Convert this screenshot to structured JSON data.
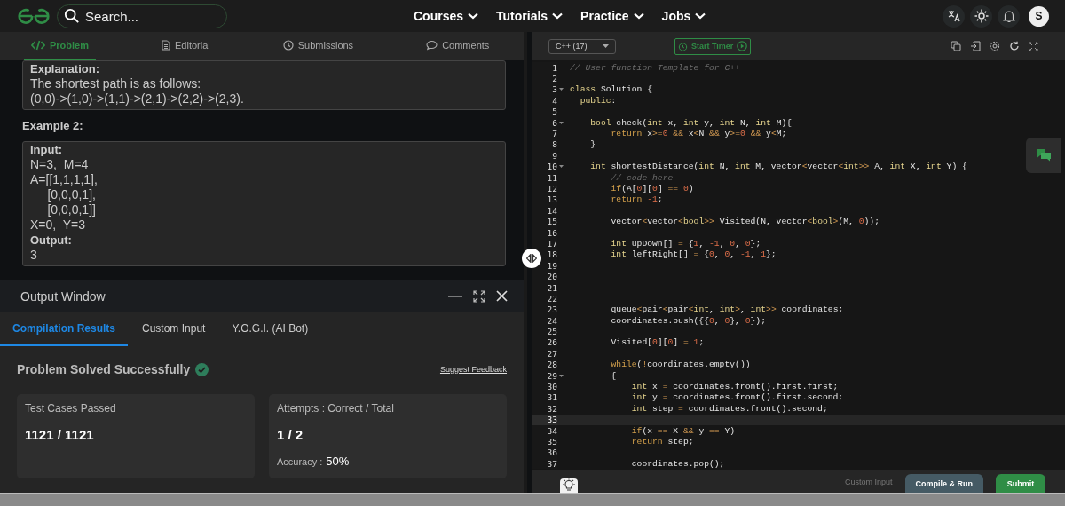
{
  "header": {
    "search": {
      "placeholder": "Search..."
    },
    "nav": [
      {
        "label": "Courses"
      },
      {
        "label": "Tutorials"
      },
      {
        "label": "Practice"
      },
      {
        "label": "Jobs"
      }
    ],
    "avatar": "S"
  },
  "problem_tabs": [
    {
      "label": "Problem",
      "selected": true
    },
    {
      "label": "Editorial",
      "selected": false
    },
    {
      "label": "Submissions",
      "selected": false
    },
    {
      "label": "Comments",
      "selected": false
    }
  ],
  "problem": {
    "explanation": {
      "heading": "Explanation:",
      "lines": [
        "The shortest path is as follows:",
        "(0,0)->(1,0)->(1,1)->(2,1)->(2,2)->(2,3)."
      ]
    },
    "example": {
      "heading": "Example 2:",
      "input_label": "Input:",
      "input_lines": [
        "N=3,  M=4",
        "A=[[1,1,1,1],",
        "     [0,0,0,1],",
        "     [0,0,0,1]]",
        "X=0,  Y=3"
      ],
      "output_label": "Output:",
      "output_lines": [
        "3"
      ]
    }
  },
  "output_window": {
    "title": "Output Window",
    "tabs": [
      {
        "label": "Compilation Results",
        "selected": true
      },
      {
        "label": "Custom Input",
        "selected": false
      },
      {
        "label": "Y.O.G.I. (AI Bot)",
        "selected": false
      }
    ],
    "status": "Problem Solved Successfully",
    "feedback_link": "Suggest Feedback",
    "cards": [
      {
        "label": "Test Cases Passed",
        "value": "1121 / 1121"
      },
      {
        "label": "Attempts : Correct / Total",
        "value": "1 / 2",
        "accuracy_label": "Accuracy :",
        "accuracy_value": "50%"
      }
    ]
  },
  "editor": {
    "language": "C++ (17)",
    "timer": "Start Timer",
    "lines": [
      {
        "number": "1",
        "fold": false,
        "current": false,
        "segments": [
          {
            "kind": "cmt",
            "text": "// User function Template for C++"
          }
        ]
      },
      {
        "number": "2",
        "fold": false,
        "current": false
      },
      {
        "number": "3",
        "fold": true,
        "current": false,
        "segments": [
          {
            "kind": "kw",
            "text": "class"
          },
          {
            "kind": "txt",
            "text": " Solution {"
          }
        ]
      },
      {
        "number": "4",
        "fold": false,
        "current": false,
        "segments": [
          {
            "kind": "kw",
            "text": "  public"
          },
          {
            "kind": "txt",
            "text": ":"
          }
        ]
      },
      {
        "number": "5",
        "fold": false,
        "current": false
      },
      {
        "number": "6",
        "fold": true,
        "current": false,
        "segments": [
          {
            "kind": "kw",
            "text": "    bool"
          },
          {
            "kind": "txt",
            "text": " check("
          },
          {
            "kind": "kw",
            "text": "int"
          },
          {
            "kind": "txt",
            "text": " x, "
          },
          {
            "kind": "kw",
            "text": "int"
          },
          {
            "kind": "txt",
            "text": " y, "
          },
          {
            "kind": "kw",
            "text": "int"
          },
          {
            "kind": "txt",
            "text": " N, "
          },
          {
            "kind": "kw",
            "text": "int"
          },
          {
            "kind": "txt",
            "text": " M){"
          }
        ]
      },
      {
        "number": "7",
        "fold": false,
        "current": false,
        "segments": [
          {
            "kind": "ctrl",
            "text": "        return"
          },
          {
            "kind": "txt",
            "text": " x"
          },
          {
            "kind": "op",
            "text": ">="
          },
          {
            "kind": "num",
            "text": "0"
          },
          {
            "kind": "op",
            "text": " && "
          },
          {
            "kind": "txt",
            "text": "x"
          },
          {
            "kind": "op",
            "text": "<"
          },
          {
            "kind": "txt",
            "text": "N "
          },
          {
            "kind": "op",
            "text": "&&"
          },
          {
            "kind": "txt",
            "text": " y"
          },
          {
            "kind": "op",
            "text": ">="
          },
          {
            "kind": "num",
            "text": "0"
          },
          {
            "kind": "op",
            "text": " && "
          },
          {
            "kind": "txt",
            "text": "y"
          },
          {
            "kind": "op",
            "text": "<"
          },
          {
            "kind": "txt",
            "text": "M;"
          }
        ]
      },
      {
        "number": "8",
        "fold": false,
        "current": false,
        "segments": [
          {
            "kind": "txt",
            "text": "    }"
          }
        ]
      },
      {
        "number": "9",
        "fold": false,
        "current": false
      },
      {
        "number": "10",
        "fold": true,
        "current": false,
        "segments": [
          {
            "kind": "kw",
            "text": "    int"
          },
          {
            "kind": "txt",
            "text": " shortestDistance("
          },
          {
            "kind": "kw",
            "text": "int"
          },
          {
            "kind": "txt",
            "text": " N, "
          },
          {
            "kind": "kw",
            "text": "int"
          },
          {
            "kind": "txt",
            "text": " M, vector"
          },
          {
            "kind": "op",
            "text": "<"
          },
          {
            "kind": "txt",
            "text": "vector"
          },
          {
            "kind": "op",
            "text": "<"
          },
          {
            "kind": "kw",
            "text": "int"
          },
          {
            "kind": "op",
            "text": ">>"
          },
          {
            "kind": "txt",
            "text": " A, "
          },
          {
            "kind": "kw",
            "text": "int"
          },
          {
            "kind": "txt",
            "text": " X, "
          },
          {
            "kind": "kw",
            "text": "int"
          },
          {
            "kind": "txt",
            "text": " Y) {"
          }
        ]
      },
      {
        "number": "11",
        "fold": false,
        "current": false,
        "segments": [
          {
            "kind": "cmt",
            "text": "        // code here"
          }
        ]
      },
      {
        "number": "12",
        "fold": false,
        "current": false,
        "segments": [
          {
            "kind": "ctrl",
            "text": "        if"
          },
          {
            "kind": "txt",
            "text": "(A["
          },
          {
            "kind": "num",
            "text": "0"
          },
          {
            "kind": "txt",
            "text": "]["
          },
          {
            "kind": "num",
            "text": "0"
          },
          {
            "kind": "txt",
            "text": "] "
          },
          {
            "kind": "op",
            "text": "=="
          },
          {
            "kind": "num",
            "text": " 0"
          },
          {
            "kind": "txt",
            "text": ")"
          }
        ]
      },
      {
        "number": "13",
        "fold": false,
        "current": false,
        "segments": [
          {
            "kind": "ctrl",
            "text": "        return"
          },
          {
            "kind": "num",
            "text": " -1"
          },
          {
            "kind": "txt",
            "text": ";"
          }
        ]
      },
      {
        "number": "14",
        "fold": false,
        "current": false
      },
      {
        "number": "15",
        "fold": false,
        "current": false,
        "segments": [
          {
            "kind": "txt",
            "text": "        vector"
          },
          {
            "kind": "op",
            "text": "<"
          },
          {
            "kind": "txt",
            "text": "vector"
          },
          {
            "kind": "op",
            "text": "<"
          },
          {
            "kind": "kw",
            "text": "bool"
          },
          {
            "kind": "op",
            "text": ">>"
          },
          {
            "kind": "txt",
            "text": " Visited(N, vector"
          },
          {
            "kind": "op",
            "text": "<"
          },
          {
            "kind": "kw",
            "text": "bool"
          },
          {
            "kind": "op",
            "text": ">"
          },
          {
            "kind": "txt",
            "text": "(M, "
          },
          {
            "kind": "num",
            "text": "0"
          },
          {
            "kind": "txt",
            "text": "));"
          }
        ]
      },
      {
        "number": "16",
        "fold": false,
        "current": false
      },
      {
        "number": "17",
        "fold": false,
        "current": false,
        "segments": [
          {
            "kind": "kw",
            "text": "        int"
          },
          {
            "kind": "txt",
            "text": " upDown[] "
          },
          {
            "kind": "op",
            "text": "="
          },
          {
            "kind": "txt",
            "text": " {"
          },
          {
            "kind": "num",
            "text": "1"
          },
          {
            "kind": "txt",
            "text": ", "
          },
          {
            "kind": "num",
            "text": "-1"
          },
          {
            "kind": "txt",
            "text": ", "
          },
          {
            "kind": "num",
            "text": "0"
          },
          {
            "kind": "txt",
            "text": ", "
          },
          {
            "kind": "num",
            "text": "0"
          },
          {
            "kind": "txt",
            "text": "};"
          }
        ]
      },
      {
        "number": "18",
        "fold": false,
        "current": false,
        "segments": [
          {
            "kind": "kw",
            "text": "        int"
          },
          {
            "kind": "txt",
            "text": " leftRight[] "
          },
          {
            "kind": "op",
            "text": "="
          },
          {
            "kind": "txt",
            "text": " {"
          },
          {
            "kind": "num",
            "text": "0"
          },
          {
            "kind": "txt",
            "text": ", "
          },
          {
            "kind": "num",
            "text": "0"
          },
          {
            "kind": "txt",
            "text": ", "
          },
          {
            "kind": "num",
            "text": "-1"
          },
          {
            "kind": "txt",
            "text": ", "
          },
          {
            "kind": "num",
            "text": "1"
          },
          {
            "kind": "txt",
            "text": "};"
          }
        ]
      },
      {
        "number": "19",
        "fold": false,
        "current": false
      },
      {
        "number": "20",
        "fold": false,
        "current": false
      },
      {
        "number": "21",
        "fold": false,
        "current": false
      },
      {
        "number": "22",
        "fold": false,
        "current": false
      },
      {
        "number": "23",
        "fold": false,
        "current": false,
        "segments": [
          {
            "kind": "txt",
            "text": "        queue"
          },
          {
            "kind": "op",
            "text": "<"
          },
          {
            "kind": "txt",
            "text": "pair"
          },
          {
            "kind": "op",
            "text": "<"
          },
          {
            "kind": "txt",
            "text": "pair"
          },
          {
            "kind": "op",
            "text": "<"
          },
          {
            "kind": "kw",
            "text": "int"
          },
          {
            "kind": "txt",
            "text": ", "
          },
          {
            "kind": "kw",
            "text": "int"
          },
          {
            "kind": "op",
            "text": ">"
          },
          {
            "kind": "txt",
            "text": ", "
          },
          {
            "kind": "kw",
            "text": "int"
          },
          {
            "kind": "op",
            "text": ">>"
          },
          {
            "kind": "txt",
            "text": " coordinates;"
          }
        ]
      },
      {
        "number": "24",
        "fold": false,
        "current": false,
        "segments": [
          {
            "kind": "txt",
            "text": "        coordinates.push({{"
          },
          {
            "kind": "num",
            "text": "0"
          },
          {
            "kind": "txt",
            "text": ", "
          },
          {
            "kind": "num",
            "text": "0"
          },
          {
            "kind": "txt",
            "text": "}, "
          },
          {
            "kind": "num",
            "text": "0"
          },
          {
            "kind": "txt",
            "text": "});"
          }
        ]
      },
      {
        "number": "25",
        "fold": false,
        "current": false
      },
      {
        "number": "26",
        "fold": false,
        "current": false,
        "segments": [
          {
            "kind": "txt",
            "text": "        Visited["
          },
          {
            "kind": "num",
            "text": "0"
          },
          {
            "kind": "txt",
            "text": "]["
          },
          {
            "kind": "num",
            "text": "0"
          },
          {
            "kind": "txt",
            "text": "] "
          },
          {
            "kind": "op",
            "text": "="
          },
          {
            "kind": "num",
            "text": " 1"
          },
          {
            "kind": "txt",
            "text": ";"
          }
        ]
      },
      {
        "number": "27",
        "fold": false,
        "current": false
      },
      {
        "number": "28",
        "fold": false,
        "current": false,
        "segments": [
          {
            "kind": "ctrl",
            "text": "        while"
          },
          {
            "kind": "txt",
            "text": "("
          },
          {
            "kind": "op",
            "text": "!"
          },
          {
            "kind": "txt",
            "text": "coordinates.empty())"
          }
        ]
      },
      {
        "number": "29",
        "fold": true,
        "current": false,
        "segments": [
          {
            "kind": "txt",
            "text": "        {"
          }
        ]
      },
      {
        "number": "30",
        "fold": false,
        "current": false,
        "segments": [
          {
            "kind": "kw",
            "text": "            int"
          },
          {
            "kind": "txt",
            "text": " x "
          },
          {
            "kind": "op",
            "text": "="
          },
          {
            "kind": "txt",
            "text": " coordinates.front().first.first;"
          }
        ]
      },
      {
        "number": "31",
        "fold": false,
        "current": false,
        "segments": [
          {
            "kind": "kw",
            "text": "            int"
          },
          {
            "kind": "txt",
            "text": " y "
          },
          {
            "kind": "op",
            "text": "="
          },
          {
            "kind": "txt",
            "text": " coordinates.front().first.second;"
          }
        ]
      },
      {
        "number": "32",
        "fold": false,
        "current": false,
        "segments": [
          {
            "kind": "kw",
            "text": "            int"
          },
          {
            "kind": "txt",
            "text": " step "
          },
          {
            "kind": "op",
            "text": "="
          },
          {
            "kind": "txt",
            "text": " coordinates.front().second;"
          }
        ]
      },
      {
        "number": "33",
        "fold": false,
        "current": true
      },
      {
        "number": "34",
        "fold": false,
        "current": false,
        "segments": [
          {
            "kind": "ctrl",
            "text": "            if"
          },
          {
            "kind": "txt",
            "text": "(x "
          },
          {
            "kind": "op",
            "text": "=="
          },
          {
            "kind": "txt",
            "text": " X "
          },
          {
            "kind": "op",
            "text": "&&"
          },
          {
            "kind": "txt",
            "text": " y "
          },
          {
            "kind": "op",
            "text": "=="
          },
          {
            "kind": "txt",
            "text": " Y)"
          }
        ]
      },
      {
        "number": "35",
        "fold": false,
        "current": false,
        "segments": [
          {
            "kind": "ctrl",
            "text": "            return"
          },
          {
            "kind": "txt",
            "text": " step;"
          }
        ]
      },
      {
        "number": "36",
        "fold": false,
        "current": false
      },
      {
        "number": "37",
        "fold": false,
        "current": false,
        "segments": [
          {
            "kind": "txt",
            "text": "            coordinates.pop();"
          }
        ]
      }
    ],
    "custom_input": "Custom Input",
    "buttons": [
      {
        "label": "Compile & Run",
        "kind": "run"
      },
      {
        "label": "Submit",
        "kind": "submit"
      }
    ]
  }
}
